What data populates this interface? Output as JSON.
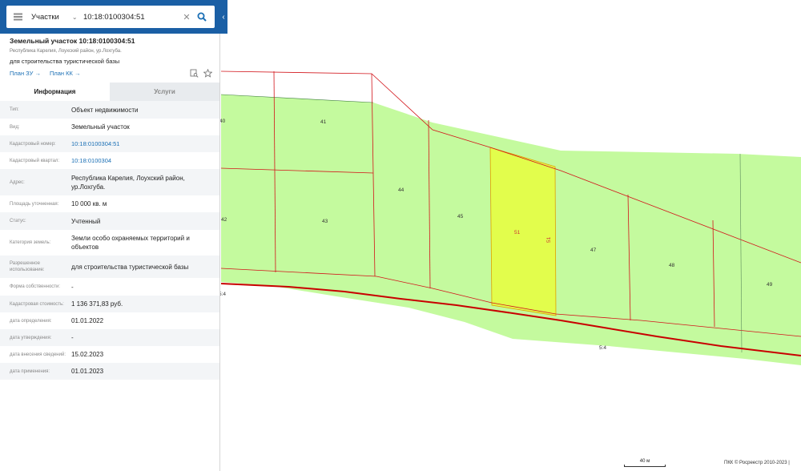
{
  "search": {
    "type_label": "Участки",
    "query": "10:18:0100304:51"
  },
  "panel": {
    "title": "Земельный участок 10:18:0100304:51",
    "address_line": "Республика Карелия, Лоухский район, ур.Лохгуба.",
    "use_line": "для строительства туристической базы",
    "link_plan_zu": "План ЗУ →",
    "link_plan_kk": "План КК →",
    "tabs": [
      "Информация",
      "Услуги"
    ],
    "rows": [
      {
        "label": "Тип:",
        "value": "Объект недвижимости"
      },
      {
        "label": "Вид:",
        "value": "Земельный участок"
      },
      {
        "label": "Кадастровый номер:",
        "value": "10:18:0100304:51"
      },
      {
        "label": "Кадастровый квартал:",
        "value": "10:18:0100304"
      },
      {
        "label": "Адрес:",
        "value": "Республика Карелия, Лоухский район, ур.Лохгуба."
      },
      {
        "label": "Площадь уточненная:",
        "value": "10 000 кв. м"
      },
      {
        "label": "Статус:",
        "value": "Учтенный"
      },
      {
        "label": "Категория земель:",
        "value": "Земли особо охраняемых территорий и объектов"
      },
      {
        "label": "Разрешенное использование:",
        "value": "для строительства туристической базы"
      },
      {
        "label": "Форма собственности:",
        "value": "-"
      },
      {
        "label": "Кадастровая стоимость:",
        "value": "1 136 371,83 руб."
      },
      {
        "label": "дата определения:",
        "value": "01.01.2022"
      },
      {
        "label": "дата утверждения:",
        "value": "-"
      },
      {
        "label": "дата внесения сведений:",
        "value": "15.02.2023"
      },
      {
        "label": "дата применения:",
        "value": "01.01.2023"
      }
    ]
  },
  "map": {
    "parcel_labels": [
      "40",
      "41",
      "42",
      "43",
      "44",
      "45",
      "51",
      "47",
      "48",
      "49"
    ],
    "selected_parcel_label": "51",
    "selected_parcel_edge_label": "51",
    "boundary_labels": [
      "5:4",
      "5:4"
    ],
    "colors": {
      "parcel_fill": "#c4fa9e",
      "selected_fill": "#e2fd4c",
      "boundary": "#d2141a",
      "road": "#c80000",
      "search_bar": "#1a5fa5",
      "link": "#1a6fb5"
    }
  },
  "scale_label": "40 м",
  "attribution": "ПКК © Росреестр 2010-2023 |"
}
